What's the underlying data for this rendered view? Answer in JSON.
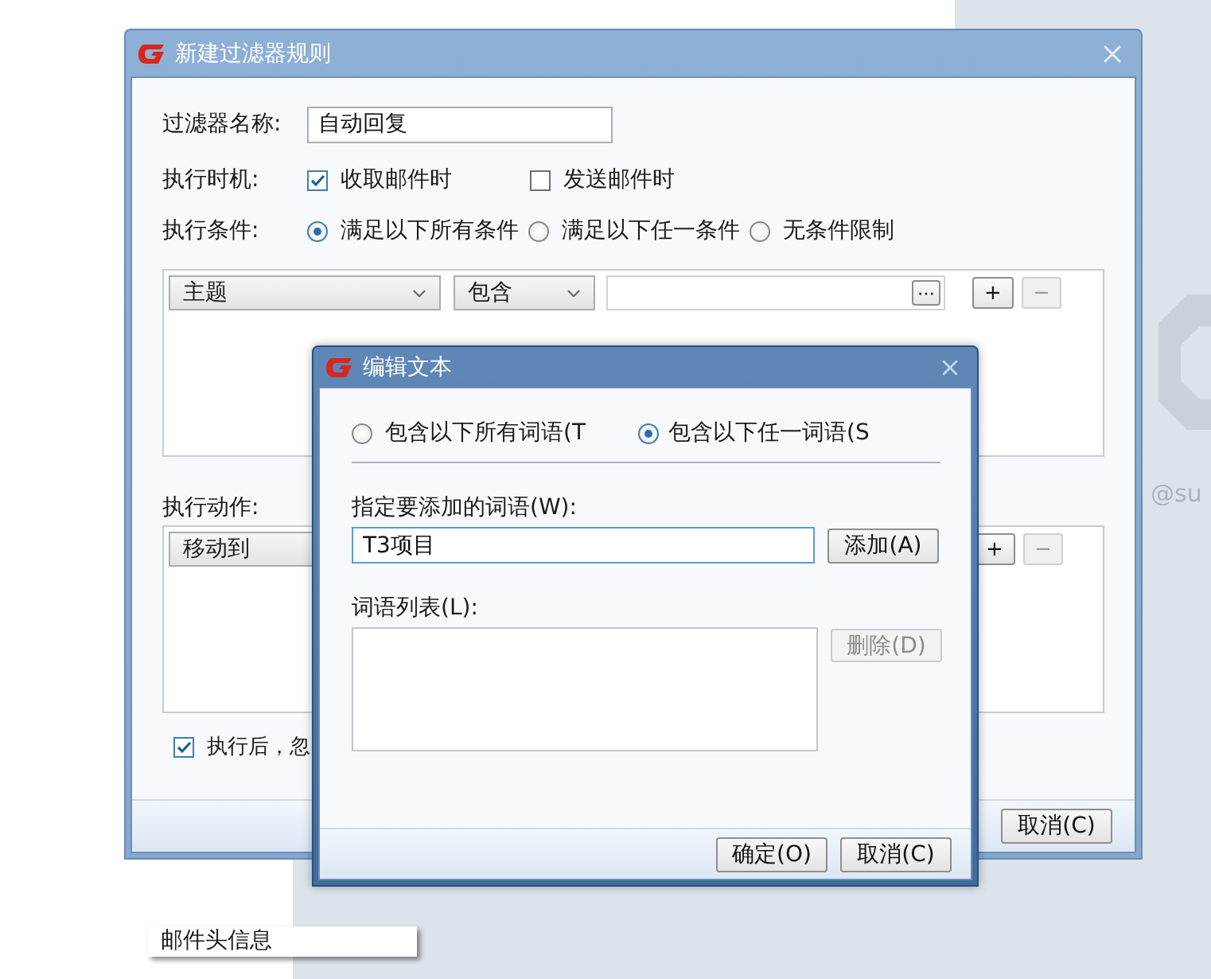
{
  "desktop": {
    "side_text": "@su",
    "menu_item": "邮件头信息"
  },
  "main_window": {
    "title": "新建过滤器规则",
    "name_label": "过滤器名称:",
    "name_value": "自动回复",
    "timing_label": "执行时机:",
    "timing_options": [
      {
        "label": "收取邮件时",
        "checked": true
      },
      {
        "label": "发送邮件时",
        "checked": false
      }
    ],
    "condition_label": "执行条件:",
    "condition_modes": [
      {
        "label": "满足以下所有条件",
        "selected": true
      },
      {
        "label": "满足以下任一条件",
        "selected": false
      },
      {
        "label": "无条件限制",
        "selected": false
      }
    ],
    "conditions": [
      {
        "field": "主题",
        "operator": "包含",
        "browse_button": "⋯",
        "add_button": "+",
        "remove_button": "−",
        "remove_disabled": true
      }
    ],
    "action_label": "执行动作:",
    "actions": [
      {
        "action": "移动到",
        "add_button": "+",
        "remove_button": "−",
        "remove_disabled": true
      }
    ],
    "after_option": {
      "label": "执行后，忽",
      "checked": true
    },
    "buttons": [
      "取消(C)"
    ]
  },
  "dialog": {
    "title": "编辑文本",
    "match_modes": [
      {
        "label": "包含以下所有词语(T",
        "selected": false
      },
      {
        "label": "包含以下任一词语(S",
        "selected": true
      }
    ],
    "word_label": "指定要添加的词语(W):",
    "word_value": "T3项目",
    "add_button": {
      "label": "添加(A)",
      "disabled": false
    },
    "list_label": "词语列表(L):",
    "delete_button": {
      "label": "删除(D)",
      "disabled": true
    },
    "buttons": [
      "确定(O)",
      "取消(C)"
    ]
  }
}
